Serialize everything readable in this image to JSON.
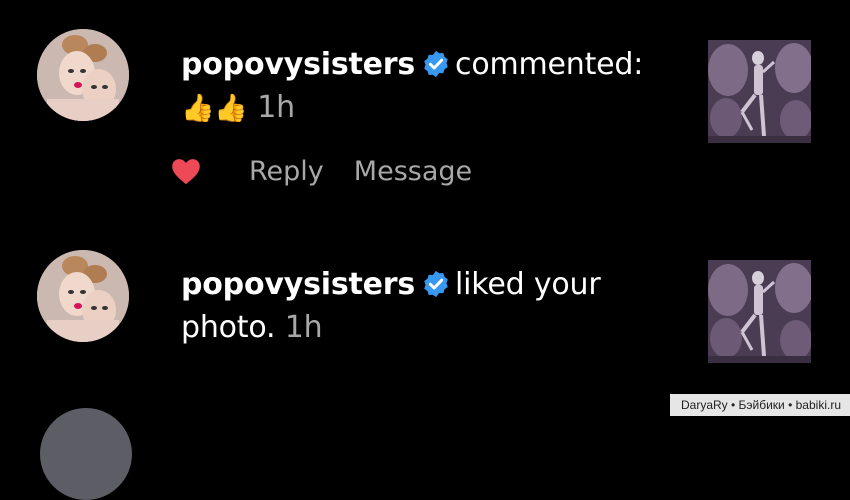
{
  "notifications": [
    {
      "username": "popovysisters",
      "verified": true,
      "action_text": "commented:",
      "comment_text": "👍👍",
      "time": "1h",
      "actions": {
        "reply_label": "Reply",
        "message_label": "Message"
      }
    },
    {
      "username": "popovysisters",
      "verified": true,
      "action_text": "liked your photo.",
      "time": "1h"
    }
  ],
  "watermark": "DaryaRy • Бэйбики • babiki.ru",
  "colors": {
    "background": "#000000",
    "username": "#ffffff",
    "secondary_text": "#a8a8a8",
    "verified_badge": "#3897f0",
    "heart": "#ed4956"
  }
}
